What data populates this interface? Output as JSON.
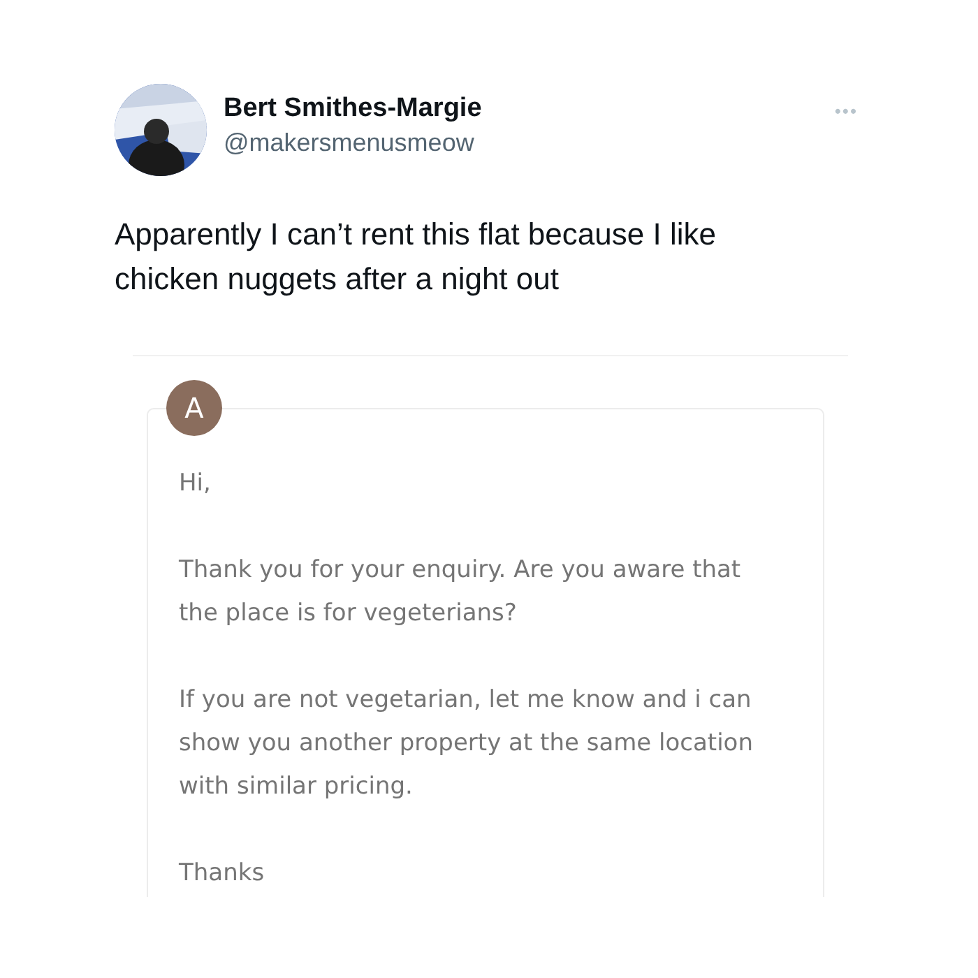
{
  "tweet": {
    "author": {
      "name": "Bert Smithes-Margie",
      "handle": "@makersmenusmeow"
    },
    "menu": "•••",
    "text": "Apparently I can’t rent this flat because I like chicken nuggets after a night out",
    "email": {
      "sender_initial": "A",
      "paragraphs": [
        "Hi,",
        "Thank you for your enquiry. Are you aware that the place is for vegeterians?",
        "If you are not vegetarian, let me know and i can show you another property at the same location with similar pricing.",
        "Thanks"
      ]
    }
  }
}
